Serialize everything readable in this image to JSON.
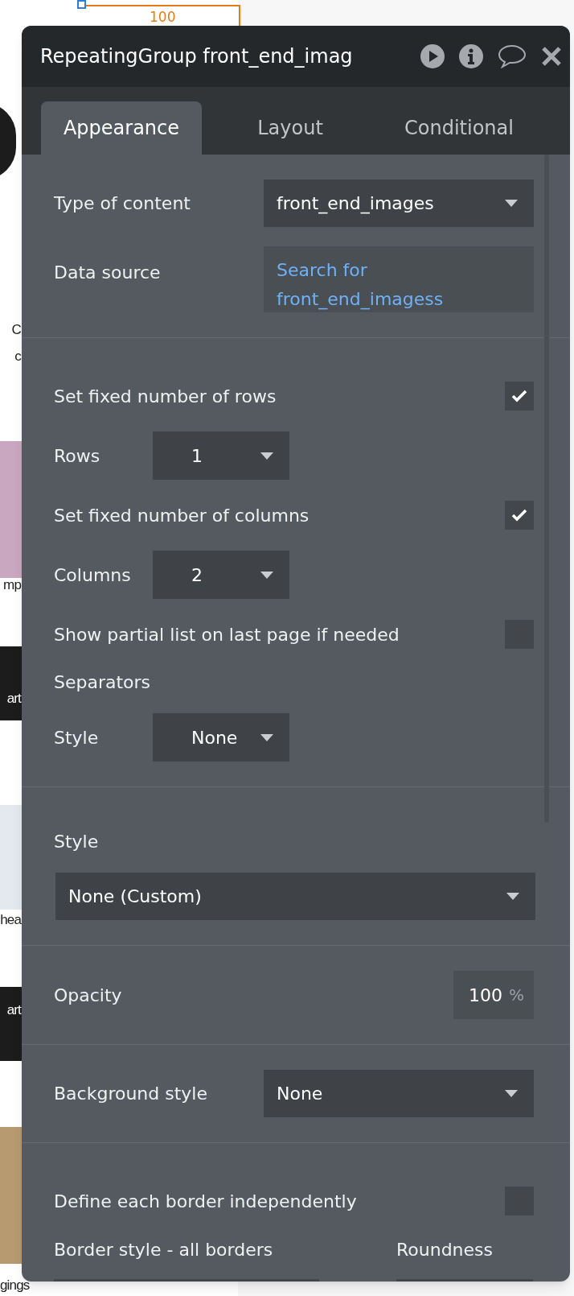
{
  "canvas": {
    "ruler_value": "100",
    "fragments": [
      "C",
      "c",
      "mp",
      "art",
      "hea",
      "art",
      "gings"
    ]
  },
  "window": {
    "title": "RepeatingGroup front_end_imag"
  },
  "tabs": [
    {
      "label": "Appearance",
      "selected": true
    },
    {
      "label": "Layout",
      "selected": false
    },
    {
      "label": "Conditional",
      "selected": false
    }
  ],
  "sections": [
    {
      "rows": [
        {
          "kind": "dropdown",
          "label": "Type of content",
          "value": "front_end_images"
        },
        {
          "kind": "link",
          "label": "Data source",
          "value": "Search for front_end_imagess"
        }
      ]
    },
    {
      "rows": [
        {
          "kind": "checkbox",
          "label": "Set fixed number of rows",
          "checked": true
        },
        {
          "kind": "small_dropdown",
          "label": "Rows",
          "value": "1"
        },
        {
          "kind": "checkbox",
          "label": "Set fixed number of columns",
          "checked": true
        },
        {
          "kind": "small_dropdown",
          "label": "Columns",
          "value": "2"
        },
        {
          "kind": "checkbox",
          "label": "Show partial list on last page if needed",
          "checked": false
        },
        {
          "kind": "heading",
          "label": "Separators"
        },
        {
          "kind": "small_dropdown",
          "label": "Style",
          "value": "None"
        }
      ]
    },
    {
      "rows": [
        {
          "kind": "heading",
          "label": "Style"
        },
        {
          "kind": "full_dropdown",
          "value": "None (Custom)"
        }
      ]
    },
    {
      "rows": [
        {
          "kind": "number",
          "label": "Opacity",
          "value": "100",
          "unit": "%"
        }
      ]
    },
    {
      "rows": [
        {
          "kind": "dropdown",
          "label": "Background style",
          "value": "None"
        }
      ]
    },
    {
      "rows": [
        {
          "kind": "checkbox",
          "label": "Define each border independently",
          "checked": false
        },
        {
          "kind": "pair",
          "label": "Border style - all borders",
          "label_2": "Roundness"
        }
      ]
    }
  ]
}
